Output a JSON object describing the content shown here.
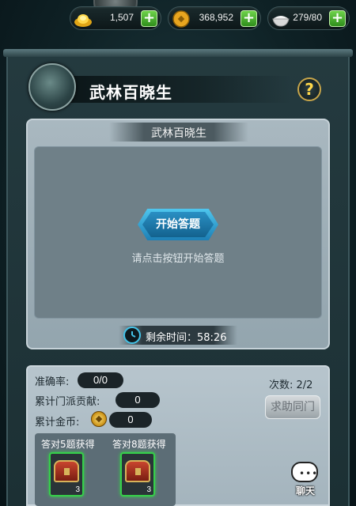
{
  "resources": {
    "gold_ingot": {
      "value": "1,507",
      "icon": "gold-ingot-icon"
    },
    "copper_coin": {
      "value": "368,952",
      "icon": "copper-coin-icon"
    },
    "rice": {
      "value": "279/80",
      "icon": "rice-bowl-icon"
    }
  },
  "panel": {
    "title": "武林百晓生",
    "help_label": "?"
  },
  "quiz": {
    "header": "武林百晓生",
    "start_button": "开始答题",
    "hint": "请点击按钮开始答题",
    "timer_text": "剩余时间：58:26"
  },
  "stats": {
    "accuracy_label": "准确率:",
    "accuracy_value": "0/0",
    "contribution_label": "累计门派贡献:",
    "contribution_value": "0",
    "gold_label": "累计金币:",
    "gold_value": "0",
    "attempts_text": "次数: 2/2",
    "help_button": "求助同门"
  },
  "rewards": [
    {
      "label": "答对5题获得",
      "count": "3"
    },
    {
      "label": "答对8题获得",
      "count": "3"
    }
  ],
  "chat": {
    "label": "聊天",
    "dots": "•••"
  },
  "colors": {
    "accent": "#36d04a",
    "timer_ring": "#43c3e8",
    "help_icon": "#ffd84a"
  }
}
